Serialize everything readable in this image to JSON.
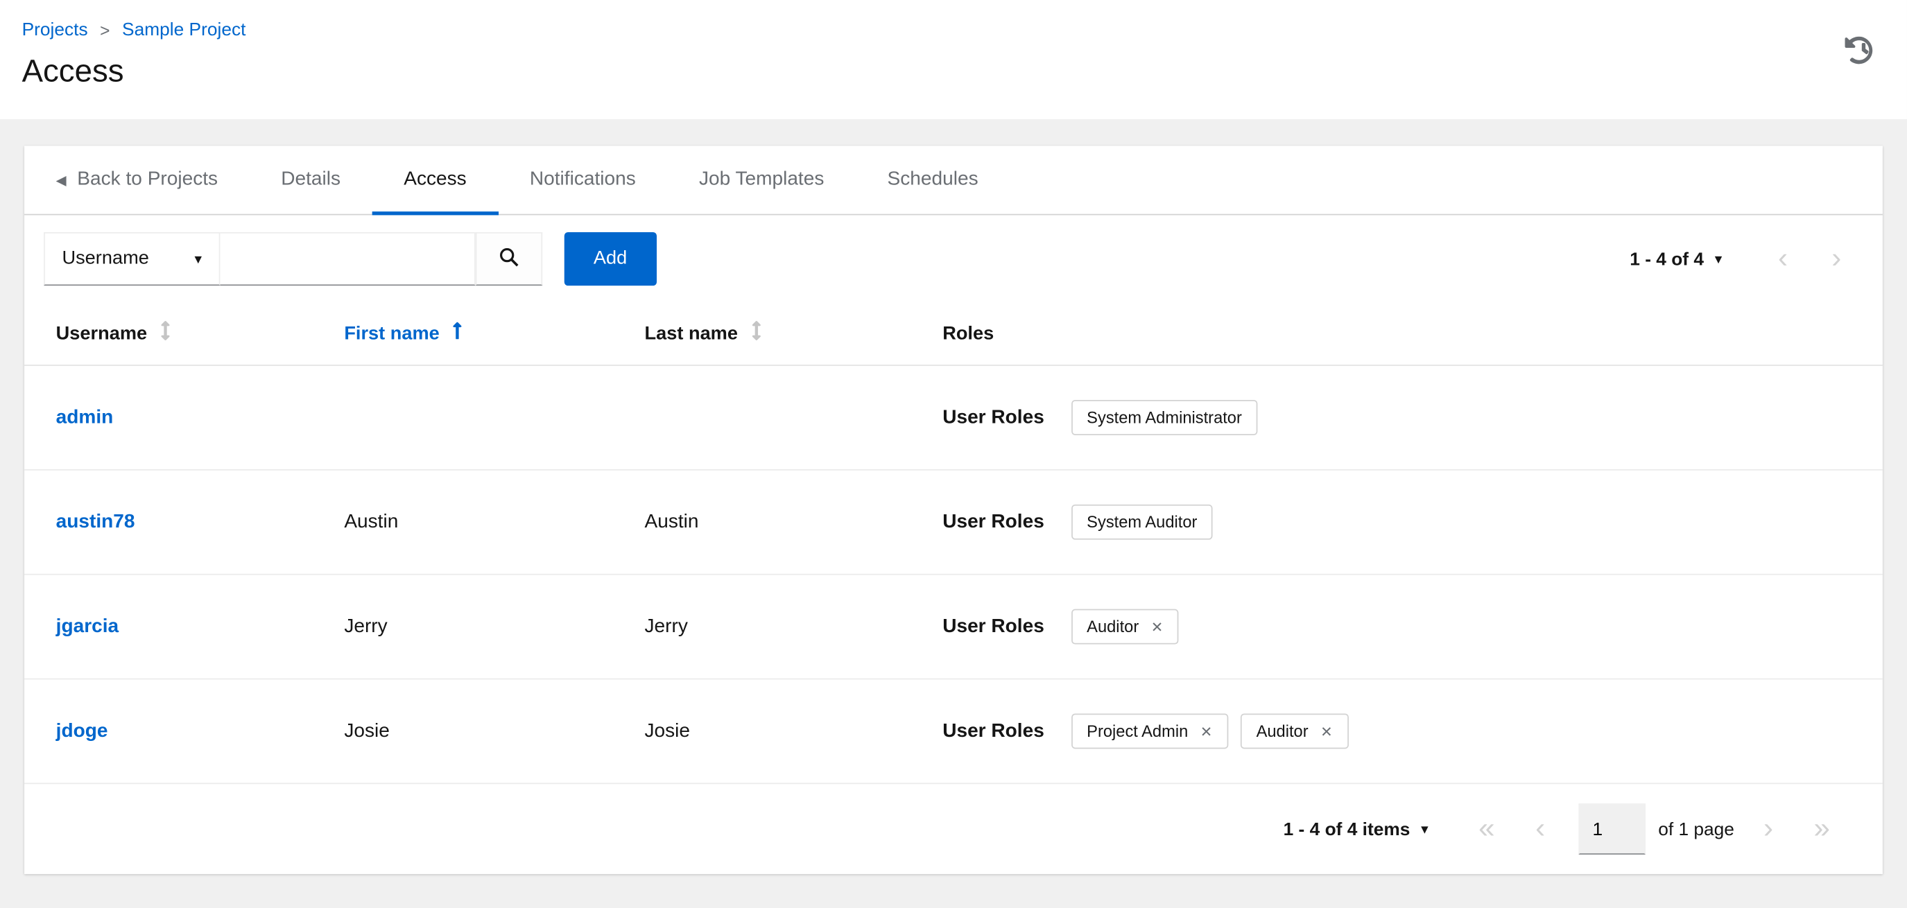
{
  "breadcrumb": {
    "items": [
      "Projects",
      "Sample Project"
    ],
    "separator": ">"
  },
  "page": {
    "title": "Access"
  },
  "icons": {
    "history": "history-icon",
    "back_arrow": "◀",
    "caret_down": "▾",
    "chevron_left": "‹",
    "chevron_right": "›",
    "chevron_double_left": "«",
    "chevron_double_right": "»",
    "chip_close": "✕"
  },
  "colors": {
    "primary_blue": "#0066cc",
    "text_dark": "#151515",
    "text_gray": "#6a6e73",
    "border_gray": "#d2d2d2",
    "page_bg": "#f0f0f0"
  },
  "tabs": [
    {
      "label": "Back to Projects"
    },
    {
      "label": "Details"
    },
    {
      "label": "Access",
      "active": true
    },
    {
      "label": "Notifications"
    },
    {
      "label": "Job Templates"
    },
    {
      "label": "Schedules"
    }
  ],
  "toolbar": {
    "filter_label": "Username",
    "search_value": "",
    "add_label": "Add",
    "pagination_summary": "1 - 4 of 4"
  },
  "table": {
    "columns": [
      {
        "label": "Username",
        "sortable": true,
        "sorted": null
      },
      {
        "label": "First name",
        "sortable": true,
        "sorted": "asc"
      },
      {
        "label": "Last name",
        "sortable": true,
        "sorted": null
      },
      {
        "label": "Roles",
        "sortable": false,
        "sorted": null
      }
    ],
    "rows": [
      {
        "username": "admin",
        "first_name": "",
        "last_name": "",
        "roles_label": "User Roles",
        "chips": [
          {
            "label": "System Administrator",
            "removable": false
          }
        ]
      },
      {
        "username": "austin78",
        "first_name": "Austin",
        "last_name": "Austin",
        "roles_label": "User Roles",
        "chips": [
          {
            "label": "System Auditor",
            "removable": false
          }
        ]
      },
      {
        "username": "jgarcia",
        "first_name": "Jerry",
        "last_name": "Jerry",
        "roles_label": "User Roles",
        "chips": [
          {
            "label": "Auditor",
            "removable": true
          }
        ]
      },
      {
        "username": "jdoge",
        "first_name": "Josie",
        "last_name": "Josie",
        "roles_label": "User Roles",
        "chips": [
          {
            "label": "Project Admin",
            "removable": true
          },
          {
            "label": "Auditor",
            "removable": true
          }
        ]
      }
    ]
  },
  "footer": {
    "items_summary": "1 - 4 of 4 items",
    "current_page": "1",
    "page_label": "of 1 page"
  }
}
